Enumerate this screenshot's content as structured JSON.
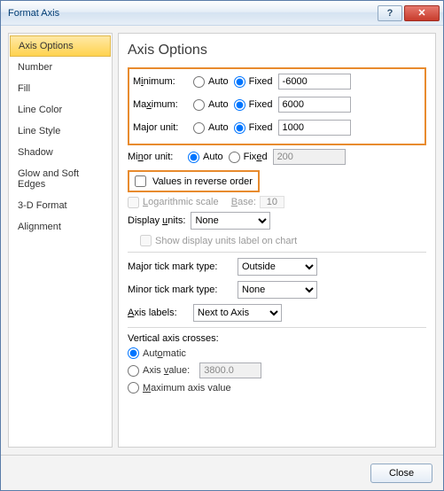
{
  "window": {
    "title": "Format Axis",
    "help": "?",
    "close": "✕"
  },
  "sidebar": {
    "items": [
      {
        "label": "Axis Options",
        "active": true
      },
      {
        "label": "Number"
      },
      {
        "label": "Fill"
      },
      {
        "label": "Line Color"
      },
      {
        "label": "Line Style"
      },
      {
        "label": "Shadow"
      },
      {
        "label": "Glow and Soft Edges"
      },
      {
        "label": "3-D Format"
      },
      {
        "label": "Alignment"
      }
    ]
  },
  "content": {
    "heading": "Axis Options",
    "auto": "Auto",
    "fixed": "Fixed",
    "rows": [
      {
        "label": "Minimum:",
        "ul": "",
        "selected": "fixed",
        "value": "-6000"
      },
      {
        "label": "Maximum:",
        "ul": "",
        "selected": "fixed",
        "value": "6000"
      },
      {
        "label": "Major unit:",
        "ul": "",
        "selected": "fixed",
        "value": "1000"
      }
    ],
    "minor": {
      "label": "Minor unit:",
      "selected": "auto",
      "value": "200"
    },
    "reverse": "Values in reverse order",
    "log": {
      "label": "Logarithmic scale",
      "base_label": "Base:",
      "base": "10"
    },
    "display_units": {
      "label": "Display units:",
      "value": "None",
      "show_label": "Show display units label on chart"
    },
    "major_tick": {
      "label": "Major tick mark type:",
      "value": "Outside"
    },
    "minor_tick": {
      "label": "Minor tick mark type:",
      "value": "None"
    },
    "axis_labels": {
      "label": "Axis labels:",
      "value": "Next to Axis"
    },
    "crosses": {
      "label": "Vertical axis crosses:",
      "auto": "Automatic",
      "axis_value_label": "Axis value:",
      "axis_value": "3800.0",
      "max": "Maximum axis value",
      "selected": "auto"
    }
  },
  "footer": {
    "close": "Close"
  }
}
